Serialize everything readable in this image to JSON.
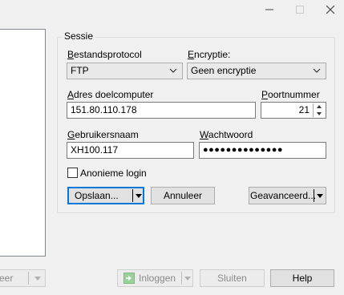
{
  "window": {
    "minimize_icon": "minimize-icon",
    "maximize_icon": "maximize-icon",
    "close_icon": "close-icon"
  },
  "session": {
    "group_label": "Sessie",
    "protocol": {
      "label_accel": "B",
      "label_rest": "estandsprotocol",
      "value": "FTP"
    },
    "encryption": {
      "label_accel": "E",
      "label_rest": "ncryptie:",
      "value": "Geen encryptie"
    },
    "host": {
      "label_accel": "A",
      "label_rest": "dres doelcomputer",
      "value": "151.80.110.178"
    },
    "port": {
      "label_accel": "P",
      "label_rest": "oortnummer",
      "value": "21"
    },
    "username": {
      "label_accel": "G",
      "label_rest": "ebruikersnaam",
      "value": "XH100.117"
    },
    "password": {
      "label_accel": "W",
      "label_rest": "achtwoord",
      "value": "●●●●●●●●●●●●●●"
    },
    "anonymous": {
      "label": "Anonieme login",
      "checked": false
    },
    "save_button": "Opslaan...",
    "cancel_button": "Annuleer",
    "advanced_button": "Geavanceerd..."
  },
  "footer": {
    "left_button_partial": "eer",
    "login_button": "Inloggen",
    "close_button": "Sluiten",
    "help_button": "Help"
  },
  "colors": {
    "focus_border": "#0078d7",
    "login_icon_green": "#3c9d3c"
  }
}
